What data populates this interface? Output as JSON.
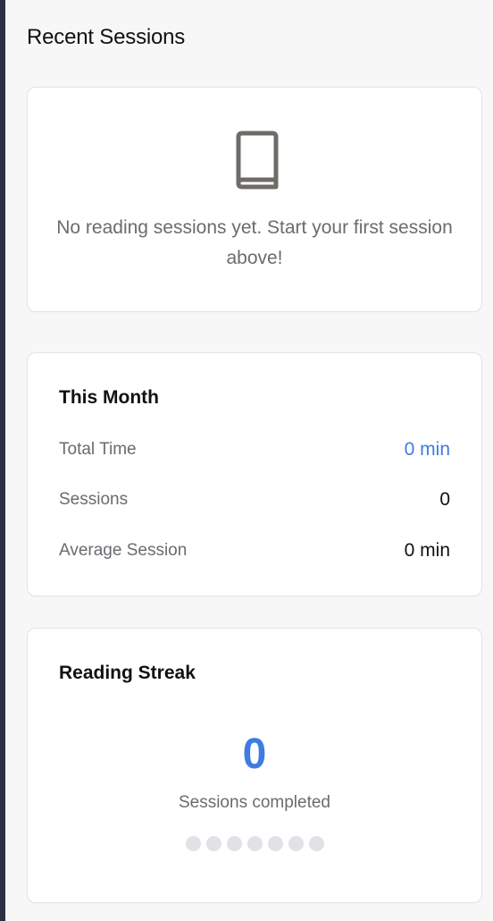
{
  "recent_sessions": {
    "title": "Recent Sessions",
    "empty_icon": "book-icon",
    "empty_message": "No reading sessions yet. Start your first session above!"
  },
  "this_month": {
    "title": "This Month",
    "rows": [
      {
        "label": "Total Time",
        "value": "0 min",
        "accent": true
      },
      {
        "label": "Sessions",
        "value": "0",
        "accent": false
      },
      {
        "label": "Average Session",
        "value": "0 min",
        "accent": false
      }
    ]
  },
  "reading_streak": {
    "title": "Reading Streak",
    "count": "0",
    "label": "Sessions completed",
    "days_total": 7,
    "days_completed": 0
  },
  "colors": {
    "accent": "#3f7be0",
    "dot_inactive": "#e1e1e6",
    "muted_text": "#6b6b70"
  }
}
